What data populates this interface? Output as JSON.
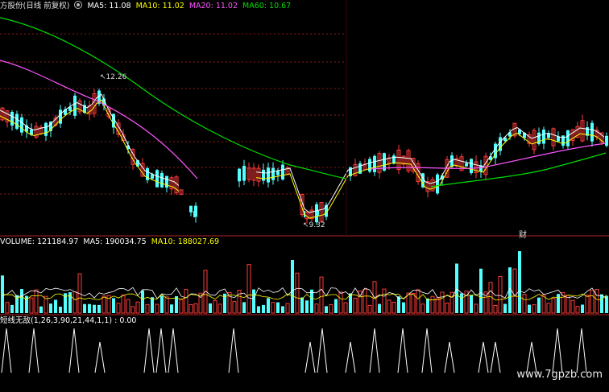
{
  "price_panel": {
    "title": "方股份(日线 前复权)",
    "ma5": "MA5: 11.08",
    "ma10": "MA10: 11.02",
    "ma20": "MA20: 11.02",
    "ma60": "MA60: 10.67",
    "high_label": "12.26",
    "low_label": "9.32",
    "marker": "财"
  },
  "volume_panel": {
    "volume": "VOLUME: 121184.97",
    "ma5": "MA5: 190034.75",
    "ma10": "MA10: 188027.69"
  },
  "indicator_panel": {
    "title": "短线无敌(1,26,3,90,21,44,1,1) : 0.00"
  },
  "watermark": "www.7gpzb.com",
  "colors": {
    "up": "#ff3b3b",
    "down": "#54ffff",
    "ma5": "#ffffff",
    "ma10": "#ffff00",
    "ma20": "#ff55ff",
    "ma60": "#00dd00",
    "grid": "#8b1a1a",
    "separator": "#b02020"
  }
}
